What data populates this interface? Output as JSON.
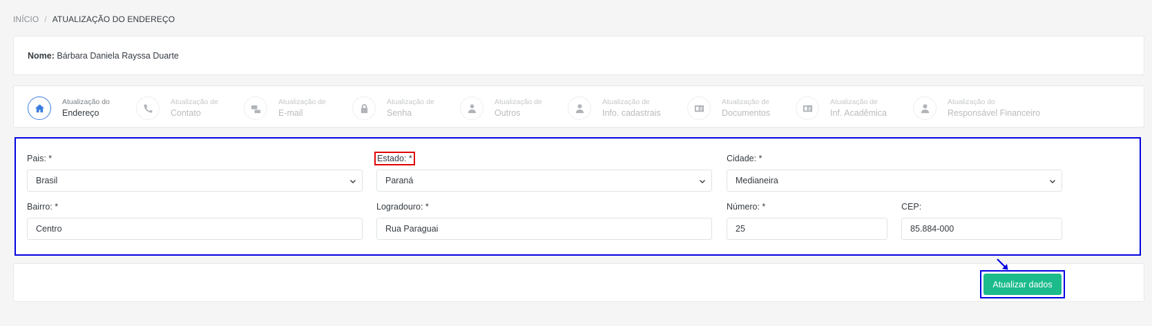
{
  "breadcrumb": {
    "home": "INÍCIO",
    "separator": "/",
    "current": "ATUALIZAÇÃO DO ENDEREÇO"
  },
  "student": {
    "name_label": "Nome:",
    "name_value": "Bárbara Daniela Rayssa Duarte"
  },
  "steps": [
    {
      "small": "Atualização do",
      "big": "Endereço",
      "icon": "home-icon",
      "active": true
    },
    {
      "small": "Atualização de",
      "big": "Contato",
      "icon": "phone-icon",
      "active": false
    },
    {
      "small": "Atualização de",
      "big": "E-mail",
      "icon": "mail-icon",
      "active": false
    },
    {
      "small": "Atualização de",
      "big": "Senha",
      "icon": "lock-icon",
      "active": false
    },
    {
      "small": "Atualização de",
      "big": "Outros",
      "icon": "user-tie-icon",
      "active": false
    },
    {
      "small": "Atualização de",
      "big": "Info. cadastrais",
      "icon": "user-icon",
      "active": false
    },
    {
      "small": "Atualização de",
      "big": "Documentos",
      "icon": "id-card-icon",
      "active": false
    },
    {
      "small": "Atualização de",
      "big": "Inf. Acadêmica",
      "icon": "id-card-icon",
      "active": false
    },
    {
      "small": "Atualização do",
      "big": "Responsável Financeiro",
      "icon": "user-icon",
      "active": false
    }
  ],
  "form": {
    "pais": {
      "label": "Pais: *",
      "value": "Brasil"
    },
    "estado": {
      "label": "Estado: *",
      "value": "Paraná"
    },
    "cidade": {
      "label": "Cidade: *",
      "value": "Medianeira"
    },
    "bairro": {
      "label": "Bairro: *",
      "value": "Centro"
    },
    "logradouro": {
      "label": "Logradouro: *",
      "value": "Rua Paraguai"
    },
    "numero": {
      "label": "Número: *",
      "value": "25"
    },
    "cep": {
      "label": "CEP:",
      "value": "85.884-000"
    }
  },
  "actions": {
    "submit_label": "Atualizar dados"
  },
  "colors": {
    "accent": "#3b7ddd",
    "success": "#1cbb8c",
    "highlight_box": "#0000e0",
    "highlight_label": "#e00000"
  }
}
